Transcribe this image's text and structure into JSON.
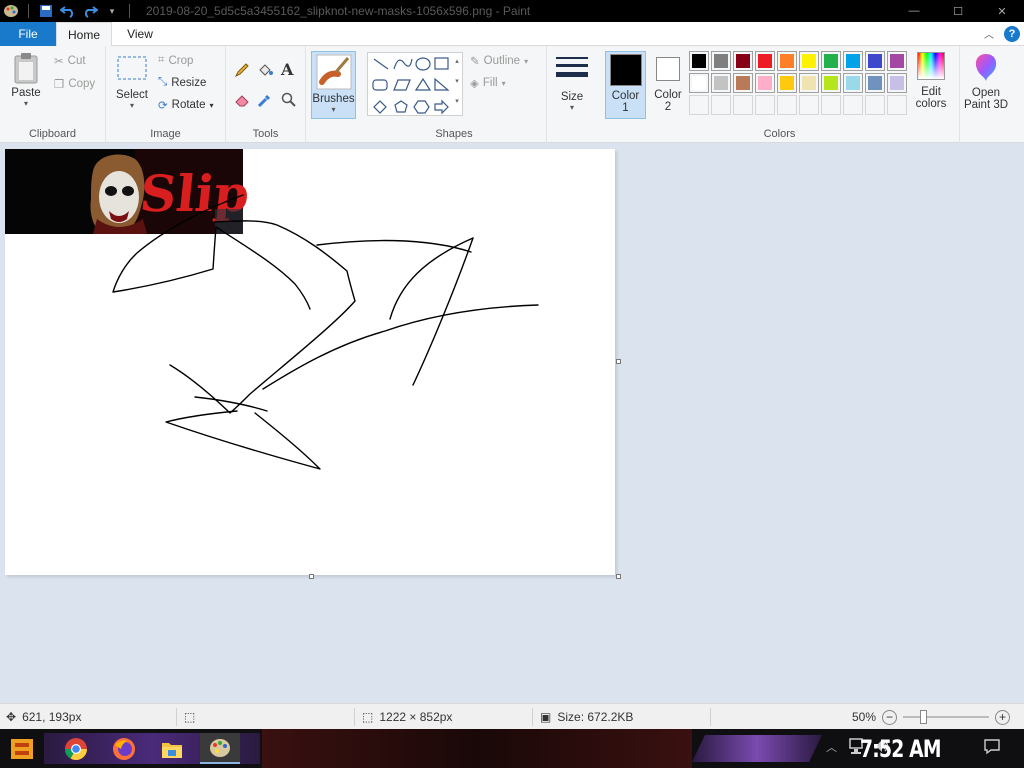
{
  "window": {
    "title": "2019-08-20_5d5c5a3455162_slipknot-new-masks-1056x596.png - Paint",
    "controls": {
      "minimize": "—",
      "maximize": "☐",
      "close": "✕"
    }
  },
  "menu": {
    "file": "File",
    "home": "Home",
    "view": "View",
    "help": "?"
  },
  "ribbon": {
    "clipboard": {
      "label": "Clipboard",
      "paste": "Paste",
      "cut": "Cut",
      "copy": "Copy"
    },
    "image": {
      "label": "Image",
      "select": "Select",
      "crop": "Crop",
      "resize": "Resize",
      "rotate": "Rotate"
    },
    "tools": {
      "label": "Tools"
    },
    "brushes": {
      "label": "Brushes"
    },
    "shapes": {
      "label": "Shapes",
      "outline": "Outline",
      "fill": "Fill"
    },
    "size": {
      "label": "Size"
    },
    "colors": {
      "label": "Colors",
      "color1": "Color\n1",
      "color1_line1": "Color",
      "color1_line2": "1",
      "color2_line1": "Color",
      "color2_line2": "2",
      "edit_line1": "Edit",
      "edit_line2": "colors",
      "color1_value": "#000000",
      "color2_value": "#ffffff",
      "palette_row1": [
        "#000000",
        "#7f7f7f",
        "#880015",
        "#ed1c24",
        "#ff7f27",
        "#fff200",
        "#22b14c",
        "#00a2e8",
        "#3f48cc",
        "#a349a4"
      ],
      "palette_row2": [
        "#ffffff",
        "#c3c3c3",
        "#b97a57",
        "#ffaec9",
        "#ffc90e",
        "#efe4b0",
        "#b5e61d",
        "#99d9ea",
        "#7092be",
        "#c8bfe7"
      ],
      "palette_row3": [
        "#f4f5f6",
        "#f4f5f6",
        "#f4f5f6",
        "#f4f5f6",
        "#f4f5f6",
        "#f4f5f6",
        "#f4f5f6",
        "#f4f5f6",
        "#f4f5f6",
        "#f4f5f6"
      ]
    },
    "paint3d": {
      "line1": "Open",
      "line2": "Paint 3D"
    }
  },
  "status": {
    "cursor_pos": "621, 193px",
    "canvas_size": "1222 × 852px",
    "file_size": "Size: 672.2KB",
    "zoom": "50%",
    "zoom_minus": "−",
    "zoom_plus": "+"
  },
  "taskbar": {
    "clock": "7:52 AM"
  },
  "image_text": "Slip"
}
